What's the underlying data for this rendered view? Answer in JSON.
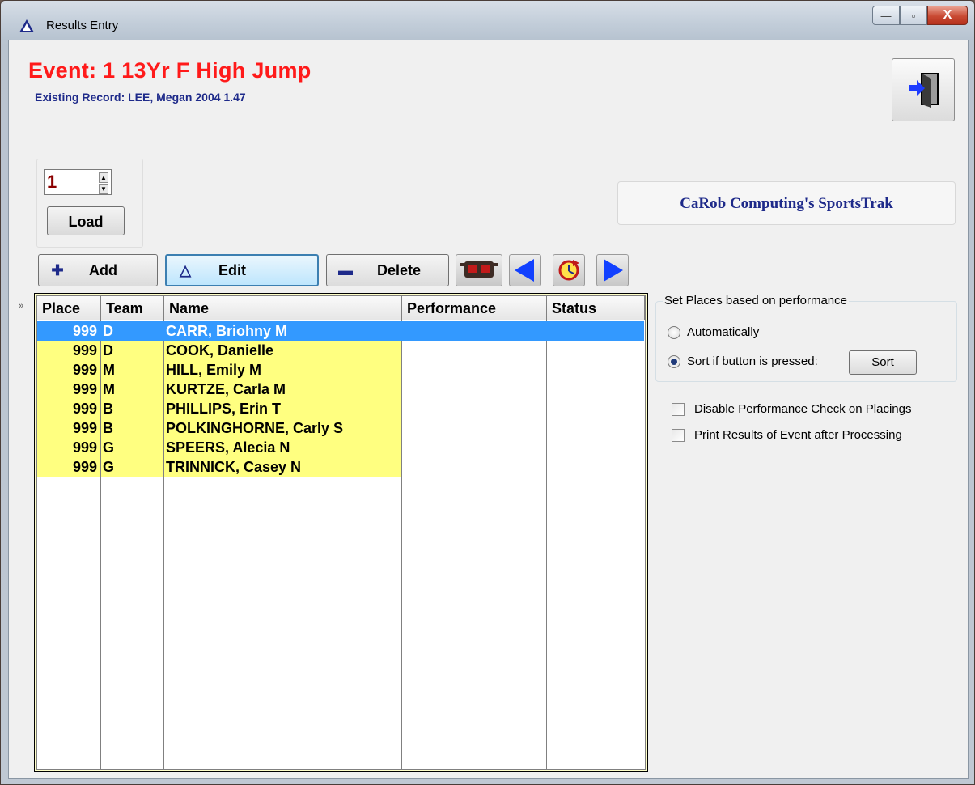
{
  "window": {
    "title": "Results Entry",
    "controls": {
      "minimize": "—",
      "maximize": "▫",
      "close": "X"
    }
  },
  "header": {
    "event_title": "Event: 1 13Yr  F  High Jump",
    "record": "Existing Record: LEE, Megan 2004 1.47"
  },
  "load": {
    "spinner_value": "1",
    "load_label": "Load"
  },
  "brand": "CaRob Computing's SportsTrak",
  "toolbar": {
    "add_label": "Add",
    "edit_label": "Edit",
    "delete_label": "Delete"
  },
  "grid": {
    "side_marker": "»",
    "columns": [
      "Place",
      "Team",
      "Name",
      "Performance",
      "Status"
    ],
    "rows": [
      {
        "place": "999",
        "team": "D",
        "name": "CARR, Briohny M",
        "performance": "",
        "status": "",
        "selected": true
      },
      {
        "place": "999",
        "team": "D",
        "name": "COOK, Danielle",
        "performance": "",
        "status": ""
      },
      {
        "place": "999",
        "team": "M",
        "name": "HILL, Emily M",
        "performance": "",
        "status": ""
      },
      {
        "place": "999",
        "team": "M",
        "name": "KURTZE, Carla M",
        "performance": "",
        "status": ""
      },
      {
        "place": "999",
        "team": "B",
        "name": "PHILLIPS, Erin T",
        "performance": "",
        "status": ""
      },
      {
        "place": "999",
        "team": "B",
        "name": "POLKINGHORNE, Carly S",
        "performance": "",
        "status": ""
      },
      {
        "place": "999",
        "team": "G",
        "name": "SPEERS, Alecia N",
        "performance": "",
        "status": ""
      },
      {
        "place": "999",
        "team": "G",
        "name": "TRINNICK, Casey N",
        "performance": "",
        "status": ""
      }
    ]
  },
  "places": {
    "legend": "Set Places based on performance",
    "option_auto": "Automatically",
    "option_sort": "Sort if button is pressed:",
    "sort_label": "Sort",
    "selected": "sort"
  },
  "options": {
    "disable_check": "Disable Performance Check on Placings",
    "print_results": "Print Results of Event after Processing"
  },
  "colors": {
    "event_title": "#ff1a1a",
    "record": "#1e2a8a",
    "row_highlight": "#ffff80",
    "selection": "#3399ff"
  }
}
